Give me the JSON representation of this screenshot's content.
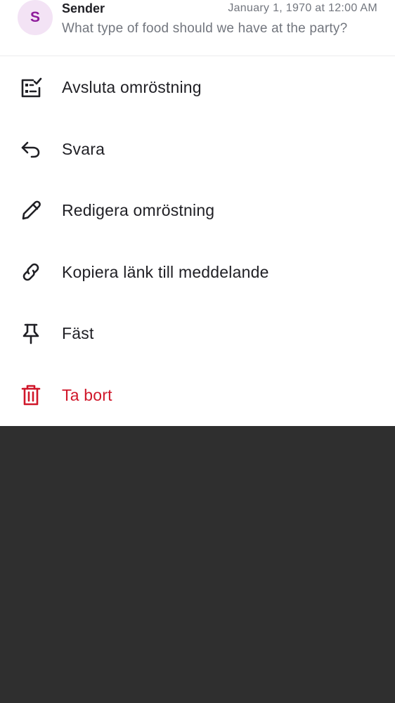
{
  "header": {
    "avatar_letter": "S",
    "sender": "Sender",
    "timestamp": "January 1, 1970 at 12:00 AM",
    "preview": "What type of food should we have at the party?"
  },
  "menu": {
    "items": [
      {
        "label": "Avsluta omröstning",
        "icon": "poll-end-icon"
      },
      {
        "label": "Svara",
        "icon": "reply-icon"
      },
      {
        "label": "Redigera omröstning",
        "icon": "edit-pencil-icon"
      },
      {
        "label": "Kopiera länk till meddelande",
        "icon": "link-icon"
      },
      {
        "label": "Fäst",
        "icon": "pin-icon"
      },
      {
        "label": "Ta bort",
        "icon": "trash-icon"
      }
    ]
  },
  "colors": {
    "avatar_bg": "#f3e3f5",
    "avatar_text": "#8e1b9b",
    "danger": "#d0172a",
    "backdrop": "#2f2f2f"
  }
}
